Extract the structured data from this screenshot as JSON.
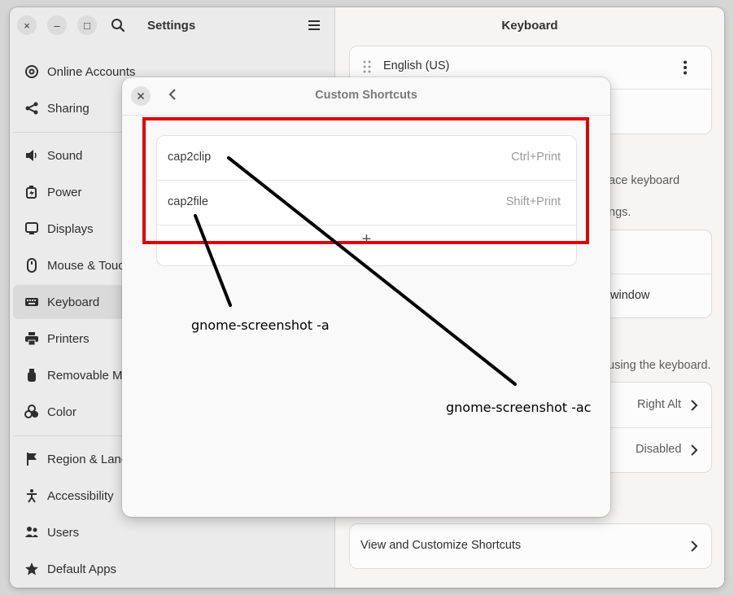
{
  "settings": {
    "title": "Settings",
    "window_buttons": {
      "close": "×",
      "minimize": "–",
      "maximize": "□"
    }
  },
  "sidebar": {
    "items": [
      {
        "label": "Online Accounts",
        "icon": "at-icon"
      },
      {
        "label": "Sharing",
        "icon": "share-icon"
      },
      {
        "label": "Sound",
        "icon": "speaker-icon"
      },
      {
        "label": "Power",
        "icon": "power-icon"
      },
      {
        "label": "Displays",
        "icon": "display-icon"
      },
      {
        "label": "Mouse & Touchpad",
        "icon": "mouse-icon"
      },
      {
        "label": "Keyboard",
        "icon": "keyboard-icon"
      },
      {
        "label": "Printers",
        "icon": "printer-icon"
      },
      {
        "label": "Removable Media",
        "icon": "usb-drive-icon"
      },
      {
        "label": "Color",
        "icon": "color-icon"
      },
      {
        "label": "Region & Language",
        "icon": "flag-icon"
      },
      {
        "label": "Accessibility",
        "icon": "accessibility-icon"
      },
      {
        "label": "Users",
        "icon": "users-icon"
      },
      {
        "label": "Default Apps",
        "icon": "star-icon"
      }
    ],
    "active": "Keyboard"
  },
  "main": {
    "title": "Keyboard",
    "input_source": "English (US)",
    "partial_1": "ace keyboard",
    "partial_2": "ngs.",
    "partial_3": "window",
    "partial_4": "using the keyboard.",
    "alternate_chars_value": "Right Alt",
    "compose_value": "Disabled",
    "view_shortcuts": "View and Customize Shortcuts"
  },
  "dialog": {
    "title": "Custom Shortcuts",
    "shortcuts": [
      {
        "name": "cap2clip",
        "accel": "Ctrl+Print"
      },
      {
        "name": "cap2file",
        "accel": "Shift+Print"
      }
    ],
    "add_symbol": "+"
  },
  "annotations": {
    "label_a": "gnome-screenshot -a",
    "label_ac": "gnome-screenshot -ac",
    "highlight_color": "#e00000"
  }
}
